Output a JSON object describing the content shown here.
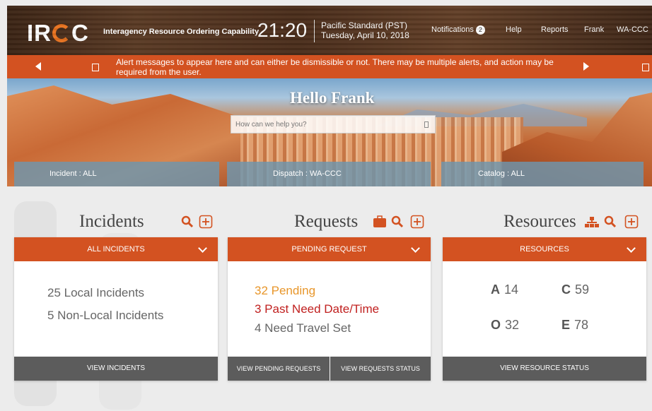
{
  "header": {
    "logo": "IROC",
    "app_title": "Interagency Resource Ordering Capability",
    "time": "21:20",
    "timezone": "Pacific Standard (PST)",
    "date": "Tuesday, April 10, 2018",
    "nav": {
      "notifications": "Notifications",
      "notifications_count": "2",
      "help": "Help",
      "reports": "Reports",
      "user": "Frank",
      "dispatch": "WA-CCC"
    }
  },
  "alert": {
    "message": "Alert messages to appear here and can either be dismissible or not. There may be multiple alerts, and action may be required from the user."
  },
  "hero": {
    "greeting": "Hello Frank",
    "search_placeholder": "How can we help you?",
    "filters": {
      "incident": "Incident : ALL",
      "dispatch": "Dispatch : WA-CCC",
      "catalog": "Catalog : ALL"
    }
  },
  "incidents": {
    "title": "Incidents",
    "dropdown": "ALL INCIDENTS",
    "local": "25 Local Incidents",
    "nonlocal": "5 Non-Local Incidents",
    "footer": "VIEW INCIDENTS"
  },
  "requests": {
    "title": "Requests",
    "dropdown": "PENDING REQUEST",
    "pending": "32 Pending",
    "past_due": "3 Past Need Date/Time",
    "travel": "4 Need Travel Set",
    "footer_left": "VIEW PENDING REQUESTS",
    "footer_right": "VIEW REQUESTS STATUS"
  },
  "resources": {
    "title": "Resources",
    "dropdown": "RESOURCES",
    "a_label": "A",
    "a_value": "14",
    "c_label": "C",
    "c_value": "59",
    "o_label": "O",
    "o_value": "32",
    "e_label": "E",
    "e_value": "78",
    "footer": "VIEW RESOURCE STATUS"
  },
  "colors": {
    "accent": "#d35221",
    "pending": "#e8962a",
    "past_due": "#c0201f",
    "footer": "#5c5c5c"
  },
  "icons": [
    "search-icon",
    "plus-square-icon",
    "briefcase-icon",
    "hierarchy-icon",
    "chevron-down-icon",
    "arrow-left-icon",
    "arrow-right-icon",
    "dismiss-icon"
  ]
}
